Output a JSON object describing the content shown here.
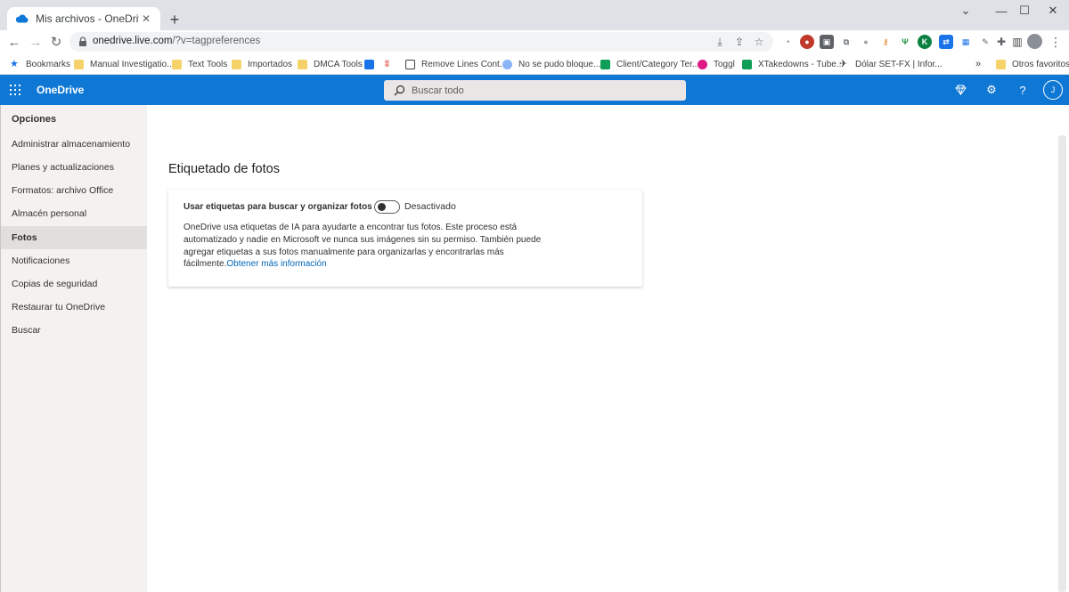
{
  "browser": {
    "tab_title": "Mis archivos - OneDrive",
    "url_host": "onedrive.live.com",
    "url_path": "/?v=tagpreferences",
    "bookmarks": [
      {
        "label": "Bookmarks",
        "icon": "star-icon"
      },
      {
        "label": "Manual Investigatio...",
        "icon": "folder-icon"
      },
      {
        "label": "Text Tools",
        "icon": "folder-icon"
      },
      {
        "label": "Importados",
        "icon": "folder-icon"
      },
      {
        "label": "DMCA Tools",
        "icon": "folder-icon"
      },
      {
        "label": "Remove Lines Cont...",
        "icon": "page-icon"
      },
      {
        "label": "No se pudo bloque...",
        "icon": "globe-icon"
      },
      {
        "label": "Client/Category Ter...",
        "icon": "sheets-icon"
      },
      {
        "label": "Toggl",
        "icon": "toggl-icon"
      },
      {
        "label": "XTakedowns - Tube...",
        "icon": "sheets-icon"
      },
      {
        "label": "Dólar SET-FX | Infor...",
        "icon": "chart-icon"
      }
    ],
    "bookmarks_overflow": "»",
    "other_bookmarks": "Otros favoritos"
  },
  "header": {
    "brand": "OneDrive",
    "search_placeholder": "Buscar todo",
    "avatar_initial": "J"
  },
  "sidebar": {
    "title": "Opciones",
    "items": [
      {
        "label": "Administrar almacenamiento"
      },
      {
        "label": "Planes y actualizaciones"
      },
      {
        "label": "Formatos: archivo Office"
      },
      {
        "label": "Almacén personal"
      },
      {
        "label": "Fotos",
        "active": true
      },
      {
        "label": "Notificaciones"
      },
      {
        "label": "Copias de seguridad"
      },
      {
        "label": "Restaurar tu OneDrive"
      },
      {
        "label": "Buscar"
      }
    ]
  },
  "main": {
    "title": "Etiquetado de fotos",
    "card": {
      "label": "Usar etiquetas para buscar y organizar fotos",
      "toggle_state": "Desactivado",
      "toggle_on": false,
      "description": "OneDrive usa etiquetas de IA para ayudarte a encontrar tus fotos. Este proceso está automatizado y nadie en Microsoft ve nunca sus imágenes sin su permiso. También puede agregar etiquetas a sus fotos manualmente para organizarlas y encontrarlas más fácilmente.",
      "link_text": "Obtener más información"
    }
  },
  "colors": {
    "onedrive_header": "#0f78d4",
    "link": "#0067b8",
    "sidebar_bg": "#f3f2f1",
    "sidebar_active": "#e1dfdd"
  }
}
